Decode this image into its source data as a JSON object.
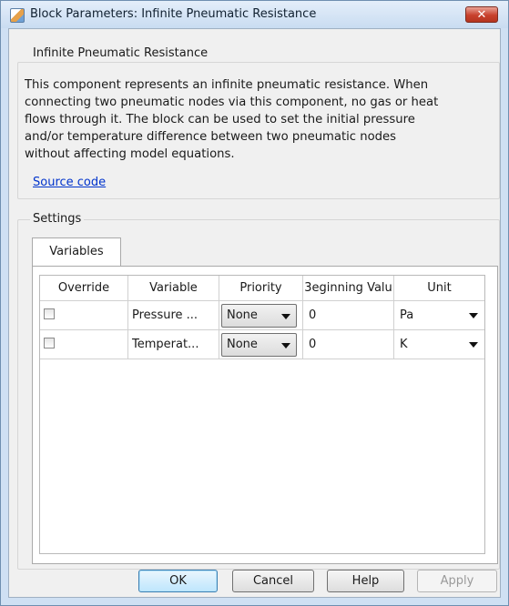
{
  "window": {
    "title": "Block Parameters: Infinite Pneumatic Resistance",
    "close_symbol": "✕"
  },
  "block": {
    "group_title": "Infinite Pneumatic Resistance",
    "description": "This component represents an infinite pneumatic resistance. When\nconnecting two pneumatic nodes via this component, no gas or heat\nflows through it. The block can be used to set the initial pressure\nand/or temperature difference between two pneumatic nodes\nwithout affecting model equations.",
    "source_link": "Source code"
  },
  "settings": {
    "group_title": "Settings",
    "tabs": [
      {
        "label": "Variables",
        "selected": true
      }
    ],
    "table": {
      "columns": [
        "Override",
        "Variable",
        "Priority",
        "3eginning Valu",
        "Unit"
      ],
      "rows": [
        {
          "override": false,
          "variable": "Pressure ...",
          "priority": "None",
          "beginning_value": "0",
          "unit": "Pa"
        },
        {
          "override": false,
          "variable": "Temperat...",
          "priority": "None",
          "beginning_value": "0",
          "unit": "K"
        }
      ]
    }
  },
  "buttons": {
    "ok": "OK",
    "cancel": "Cancel",
    "help": "Help",
    "apply": "Apply"
  },
  "icons": {
    "app": "simulink-block-icon",
    "close": "close-icon",
    "dropdown": "chevron-down-icon"
  },
  "colors": {
    "title_bar": "#c9dcf1",
    "close_button": "#c8412c",
    "link": "#0033cc",
    "default_button": "#bee6fd"
  }
}
